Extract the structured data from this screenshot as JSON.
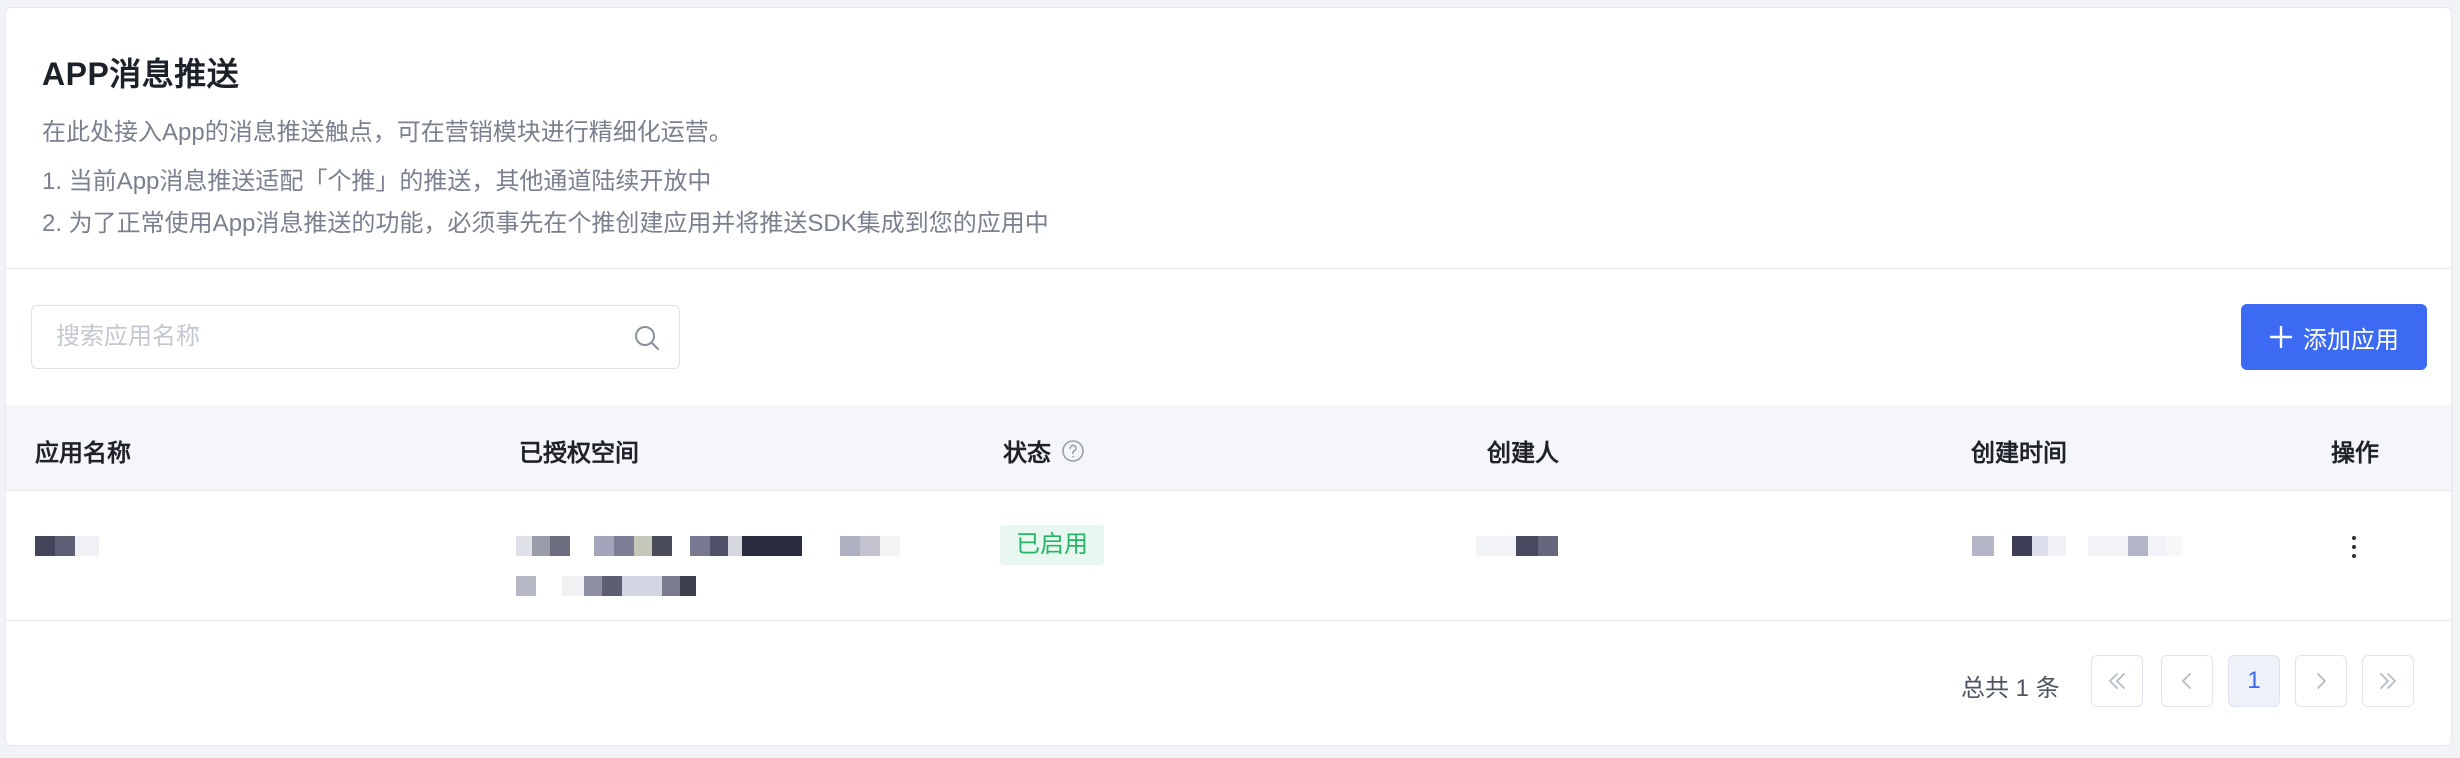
{
  "header": {
    "title": "APP消息推送",
    "description": "在此处接入App的消息推送触点，可在营销模块进行精细化运营。",
    "notes": [
      "1. 当前App消息推送适配「个推」的推送，其他通道陆续开放中",
      "2. 为了正常使用App消息推送的功能，必须事先在个推创建应用并将推送SDK集成到您的应用中"
    ]
  },
  "toolbar": {
    "search_placeholder": "搜索应用名称",
    "search_icon": "search-icon",
    "add_button_label": "添加应用",
    "add_button_icon": "plus-icon"
  },
  "table": {
    "columns": [
      "应用名称",
      "已授权空间",
      "状态",
      "创建人",
      "创建时间",
      "操作"
    ],
    "status_help_icon": "question-circle-icon",
    "rows": [
      {
        "status": "已启用",
        "actions_icon": "more-vertical-icon"
      }
    ]
  },
  "pagination": {
    "total_label": "总共 1 条",
    "current_page": "1"
  },
  "colors": {
    "primary": "#3d6af2",
    "status_success_text": "#27b467",
    "status_success_bg": "#e8f7ef"
  }
}
